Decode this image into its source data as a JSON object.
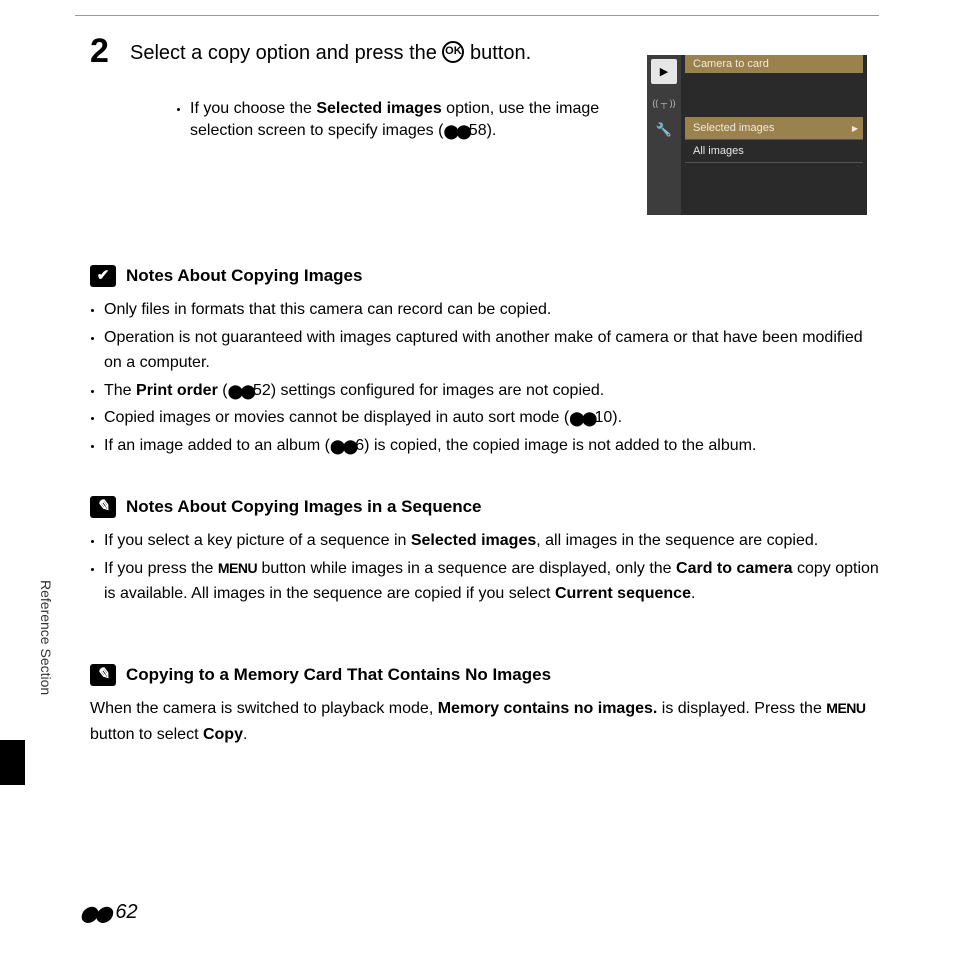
{
  "step": {
    "number": "2",
    "title_pre": "Select a copy option and press the ",
    "title_post": " button.",
    "ok_label": "OK",
    "bullet_pre": "If you choose the ",
    "bullet_strong": "Selected images",
    "bullet_mid": " option, use the image selection screen to specify images (",
    "bullet_ref": "58).",
    "ref_glyph": "⬤⬤"
  },
  "cam": {
    "header": "Camera to card",
    "item_selected": "Selected images",
    "item_all": "All images",
    "side_play": "▶",
    "side_wifi": "((  ))",
    "side_wrench": "🔧"
  },
  "notes1": {
    "icon": "✔",
    "title": "Notes About Copying Images",
    "b1": "Only files in formats that this camera can record can be copied.",
    "b2": "Operation is not guaranteed with images captured with another make of camera or that have been modified on a computer.",
    "b3_pre": "The ",
    "b3_strong": "Print order",
    "b3_mid": " (",
    "b3_ref": "52) settings configured for images are not copied.",
    "b4_pre": "Copied images or movies cannot be displayed in auto sort mode (",
    "b4_ref": "10).",
    "b5_pre": "If an image added to an album (",
    "b5_ref": "6) is copied, the copied image is not added to the album."
  },
  "notes2": {
    "icon": "✎",
    "title": "Notes About Copying Images in a Sequence",
    "b1_pre": "If you select a key picture of a sequence in ",
    "b1_strong": "Selected images",
    "b1_post": ", all images in the sequence are copied.",
    "b2_pre": "If you press the ",
    "b2_menu": "MENU",
    "b2_mid": " button while images in a sequence are displayed, only the ",
    "b2_strong1": "Card to camera",
    "b2_mid2": " copy option is available. All images in the sequence are copied if you select ",
    "b2_strong2": "Current sequence",
    "b2_post": "."
  },
  "notes3": {
    "icon": "✎",
    "title": "Copying to a Memory Card That Contains No Images",
    "p_pre": "When the camera is switched to playback mode, ",
    "p_strong1": "Memory contains no images.",
    "p_mid": " is displayed. Press the ",
    "p_menu": "MENU",
    "p_mid2": " button to select ",
    "p_strong2": "Copy",
    "p_post": "."
  },
  "sidebar": "Reference Section",
  "page_number": "62",
  "ref_icon_text": "●●"
}
